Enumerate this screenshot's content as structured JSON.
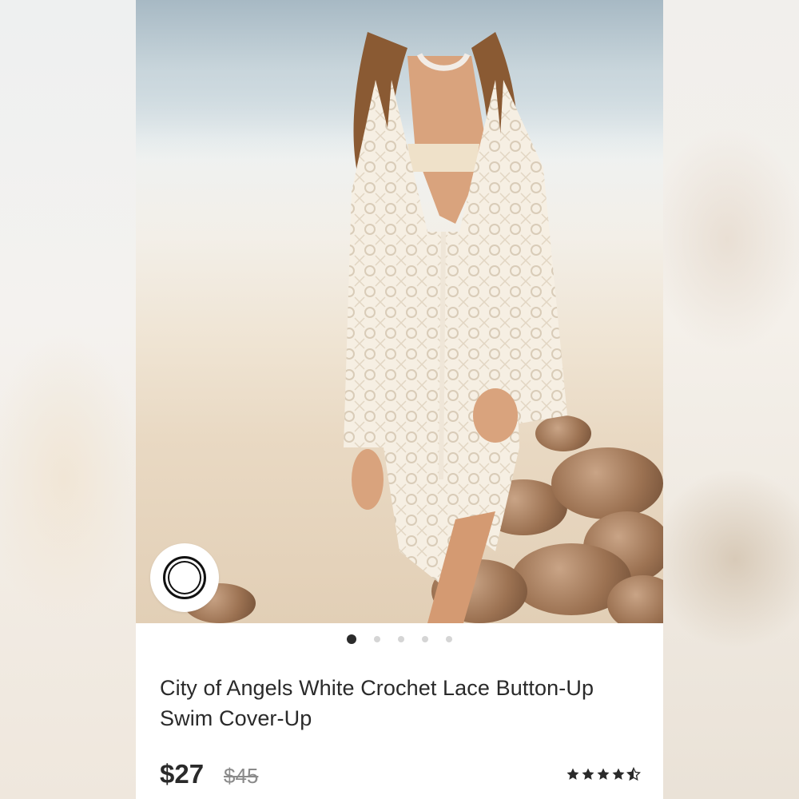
{
  "product": {
    "title": "City of Angels White Crochet Lace Button-Up Swim Cover-Up",
    "price": "$27",
    "original_price": "$45",
    "rating": 4.5
  },
  "carousel": {
    "count": 5,
    "active_index": 0
  },
  "icons": {
    "shop": "circle-ring-icon",
    "rating": "star-icon"
  },
  "colors": {
    "text": "#2a2a2a",
    "muted": "#8a8a8a",
    "dot_active": "#2b2b2b",
    "dot_inactive": "#d5d5d5"
  }
}
